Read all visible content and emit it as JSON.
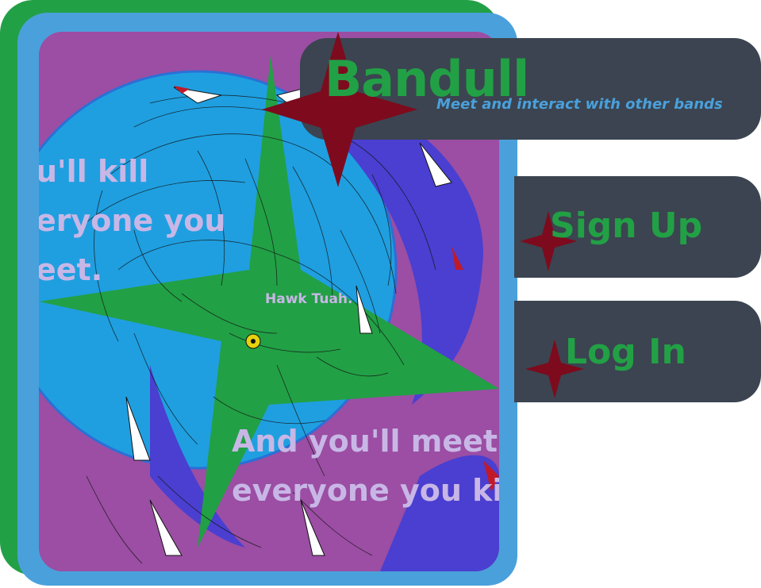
{
  "header": {
    "title": "Bandull",
    "subtitle": "Meet and interact with other bands"
  },
  "actions": {
    "signup_label": "Sign Up",
    "login_label": "Log In"
  },
  "artwork": {
    "lyric_top_line1": "u'll kill",
    "lyric_top_line2": "eryone you",
    "lyric_top_line3": "eet.",
    "caption": "Hawk Tuah.",
    "lyric_bottom_line1": "And you'll meet",
    "lyric_bottom_line2": "everyone you kil"
  },
  "colors": {
    "frame_green": "#22a045",
    "frame_blue": "#4aa0db",
    "art_purple": "#9b4ea3",
    "panel": "#3b4450",
    "star_red": "#7d0b1d",
    "brand_green": "#22a045",
    "subtitle_blue": "#4aa0db"
  },
  "icons": {
    "brand_star": "four-point-star-icon",
    "signup_star": "four-point-star-icon",
    "login_star": "four-point-star-icon"
  }
}
